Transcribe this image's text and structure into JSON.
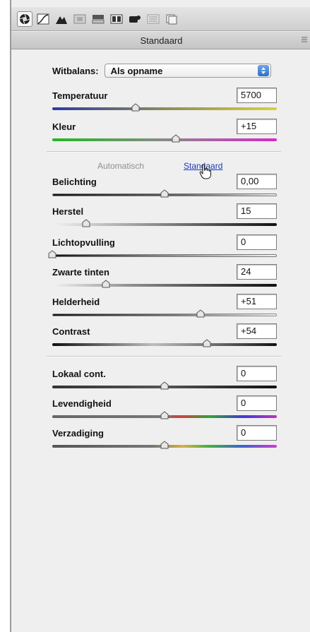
{
  "toolbar": {
    "tools": [
      {
        "icon": "aperture-icon",
        "active": true
      },
      {
        "icon": "tone-curve-icon",
        "active": false
      },
      {
        "icon": "detail-icon",
        "active": false
      },
      {
        "icon": "hsl-icon",
        "active": false
      },
      {
        "icon": "split-toning-icon",
        "active": false
      },
      {
        "icon": "lens-corrections-icon",
        "active": false
      },
      {
        "icon": "effects-icon",
        "active": false
      },
      {
        "icon": "camera-calibration-icon",
        "active": false
      },
      {
        "icon": "presets-icon",
        "active": false
      }
    ]
  },
  "header": {
    "title": "Standaard"
  },
  "white_balance": {
    "label": "Witbalans:",
    "value": "Als opname"
  },
  "temperature": {
    "label": "Temperatuur",
    "value": "5700",
    "level": 0.37
  },
  "tint": {
    "label": "Kleur",
    "value": "+15",
    "level": 0.55
  },
  "tabs": {
    "auto": "Automatisch",
    "standard": "Standaard"
  },
  "exposure": {
    "label": "Belichting",
    "value": "0,00",
    "level": 0.5
  },
  "recovery": {
    "label": "Herstel",
    "value": "15",
    "level": 0.15
  },
  "fill_light": {
    "label": "Lichtopvulling",
    "value": "0",
    "level": 0.0
  },
  "blacks": {
    "label": "Zwarte tinten",
    "value": "24",
    "level": 0.24
  },
  "brightness": {
    "label": "Helderheid",
    "value": "+51",
    "level": 0.66
  },
  "contrast": {
    "label": "Contrast",
    "value": "+54",
    "level": 0.69
  },
  "clarity": {
    "label": "Lokaal cont.",
    "value": "0",
    "level": 0.5
  },
  "vibrance": {
    "label": "Levendigheid",
    "value": "0",
    "level": 0.5
  },
  "saturation": {
    "label": "Verzadiging",
    "value": "0",
    "level": 0.5
  },
  "colors": {
    "panel_bg": "#efefef",
    "link": "#1b3bb0",
    "select_accent": "#2f6fcb"
  }
}
